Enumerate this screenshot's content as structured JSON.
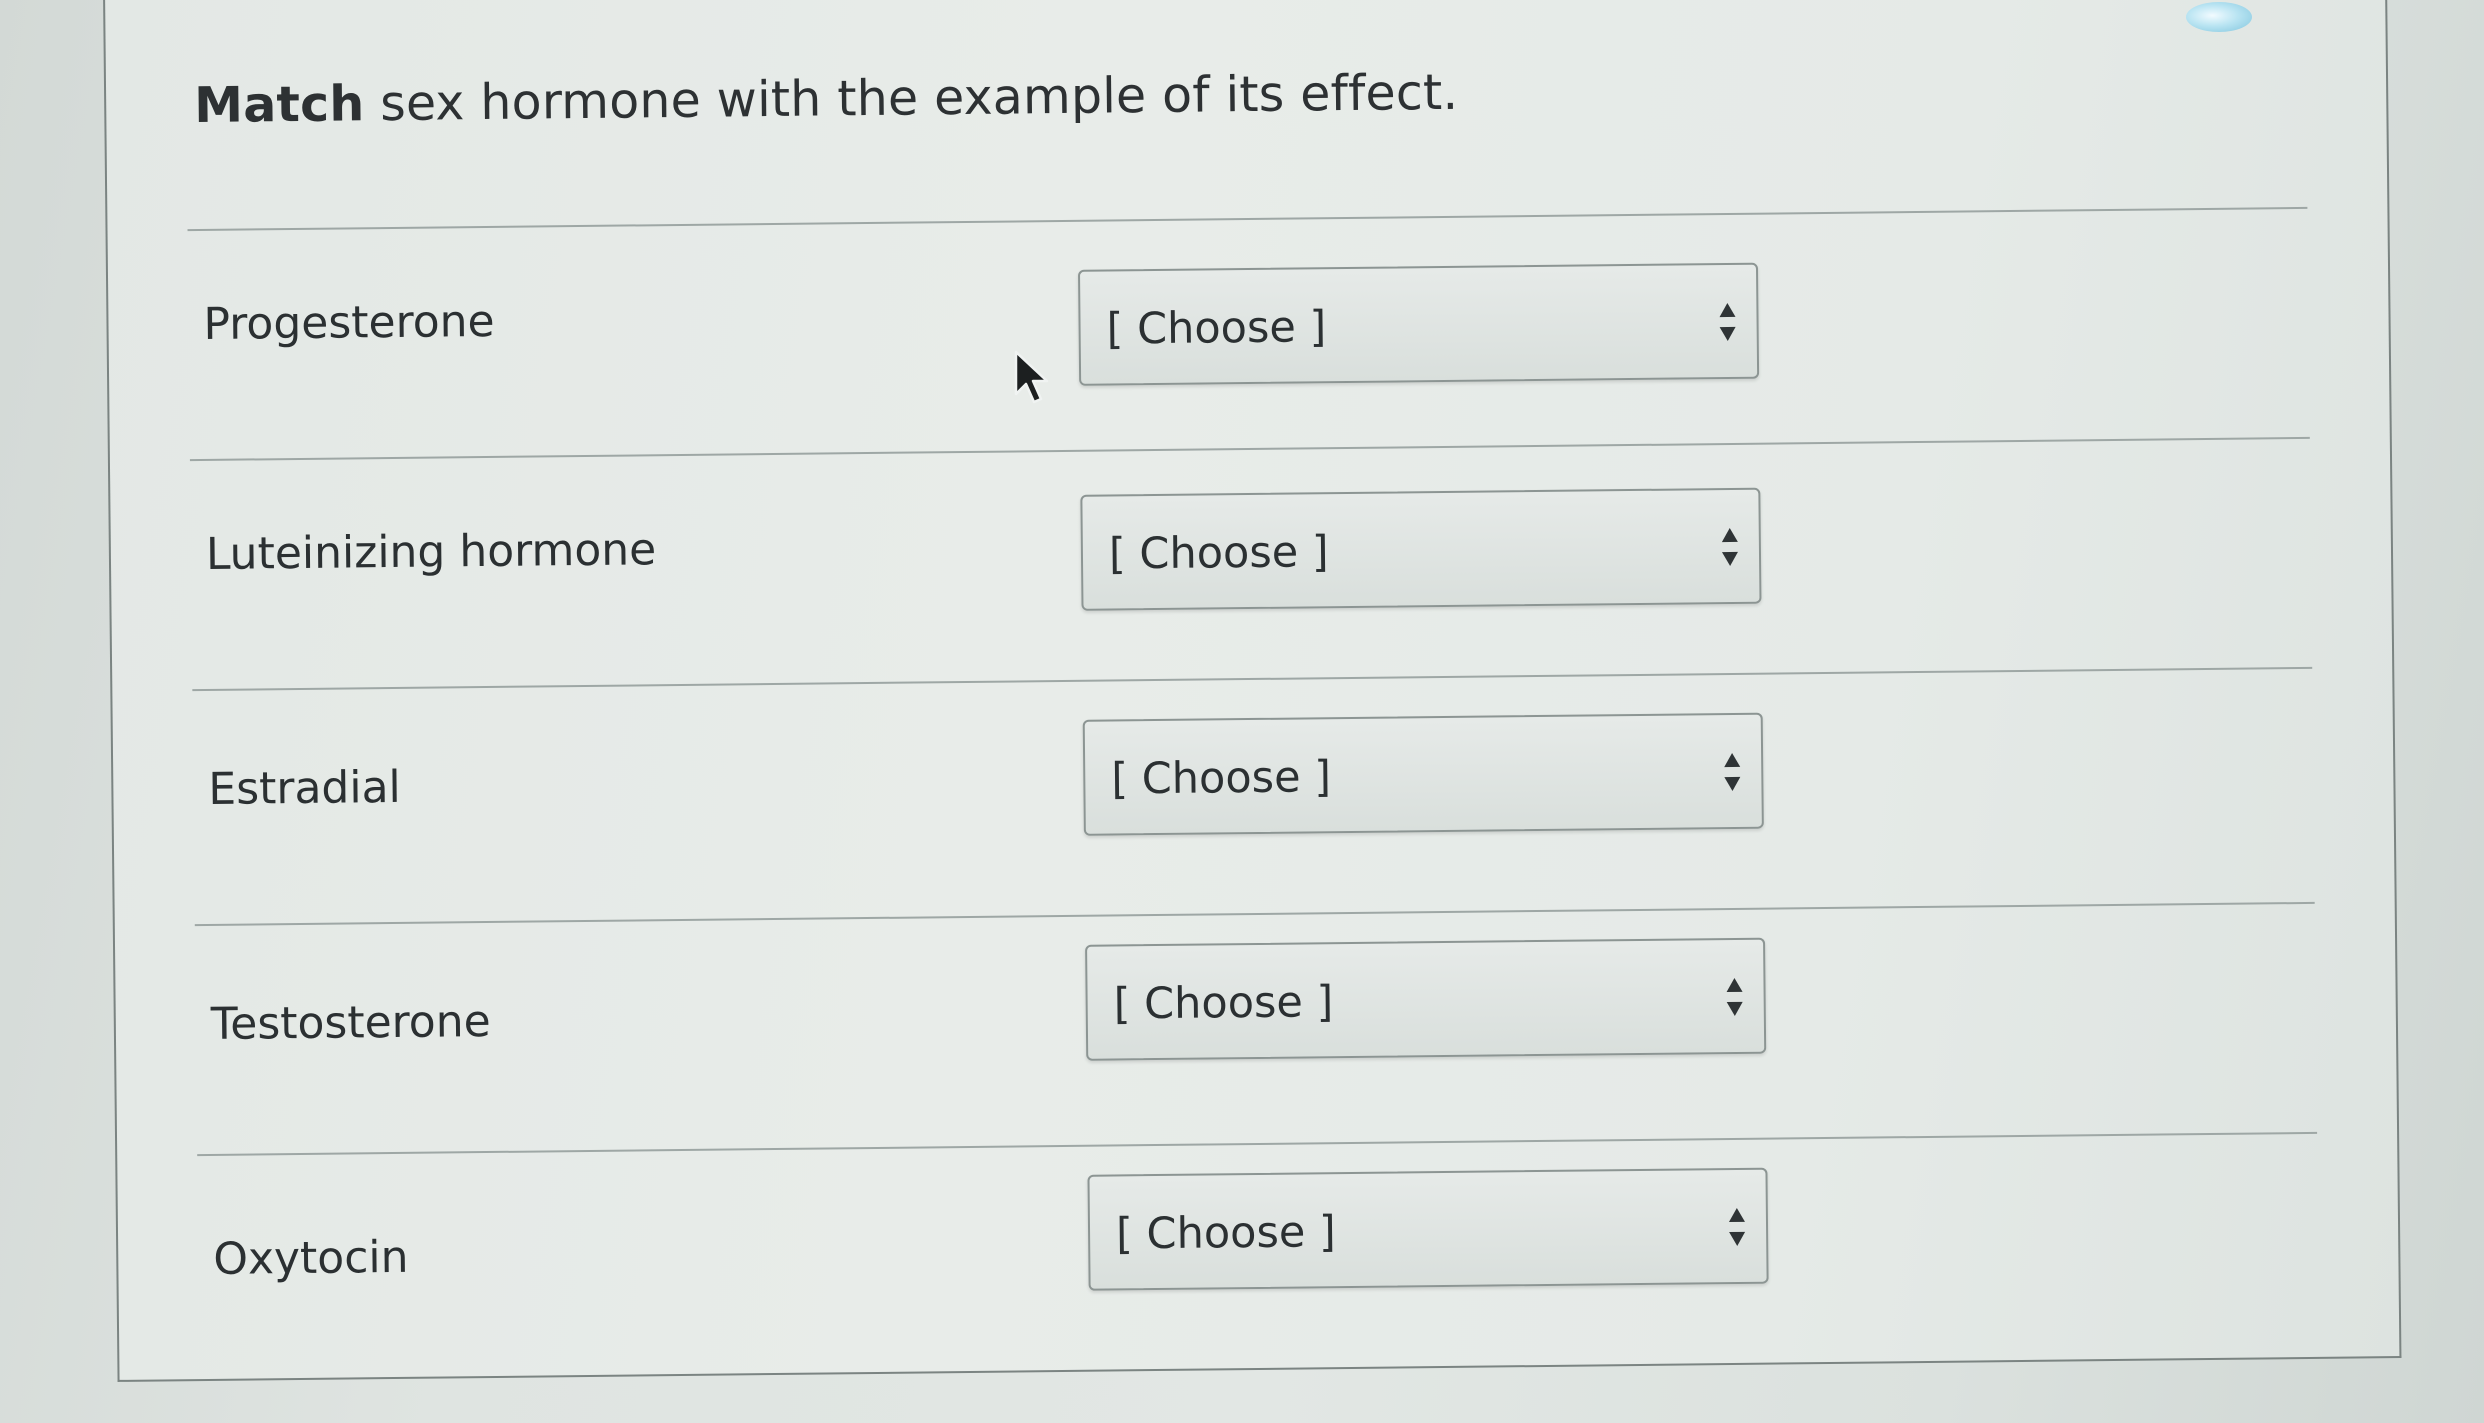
{
  "question": {
    "bold": "Match",
    "rest": " sex hormone with the example of its effect."
  },
  "rows": [
    {
      "term": "Progesterone",
      "select_value": "[ Choose ]"
    },
    {
      "term": "Luteinizing hormone",
      "select_value": "[ Choose ]"
    },
    {
      "term": "Estradial",
      "select_value": "[ Choose ]"
    },
    {
      "term": "Testosterone",
      "select_value": "[ Choose ]"
    },
    {
      "term": "Oxytocin",
      "select_value": "[ Choose ]"
    }
  ],
  "icons": {
    "select_arrow": "up-down-arrows-icon",
    "cursor": "mouse-pointer-icon"
  },
  "colors": {
    "text": "#2b3032",
    "border": "#8c9593",
    "background": "#e3e8e5"
  }
}
